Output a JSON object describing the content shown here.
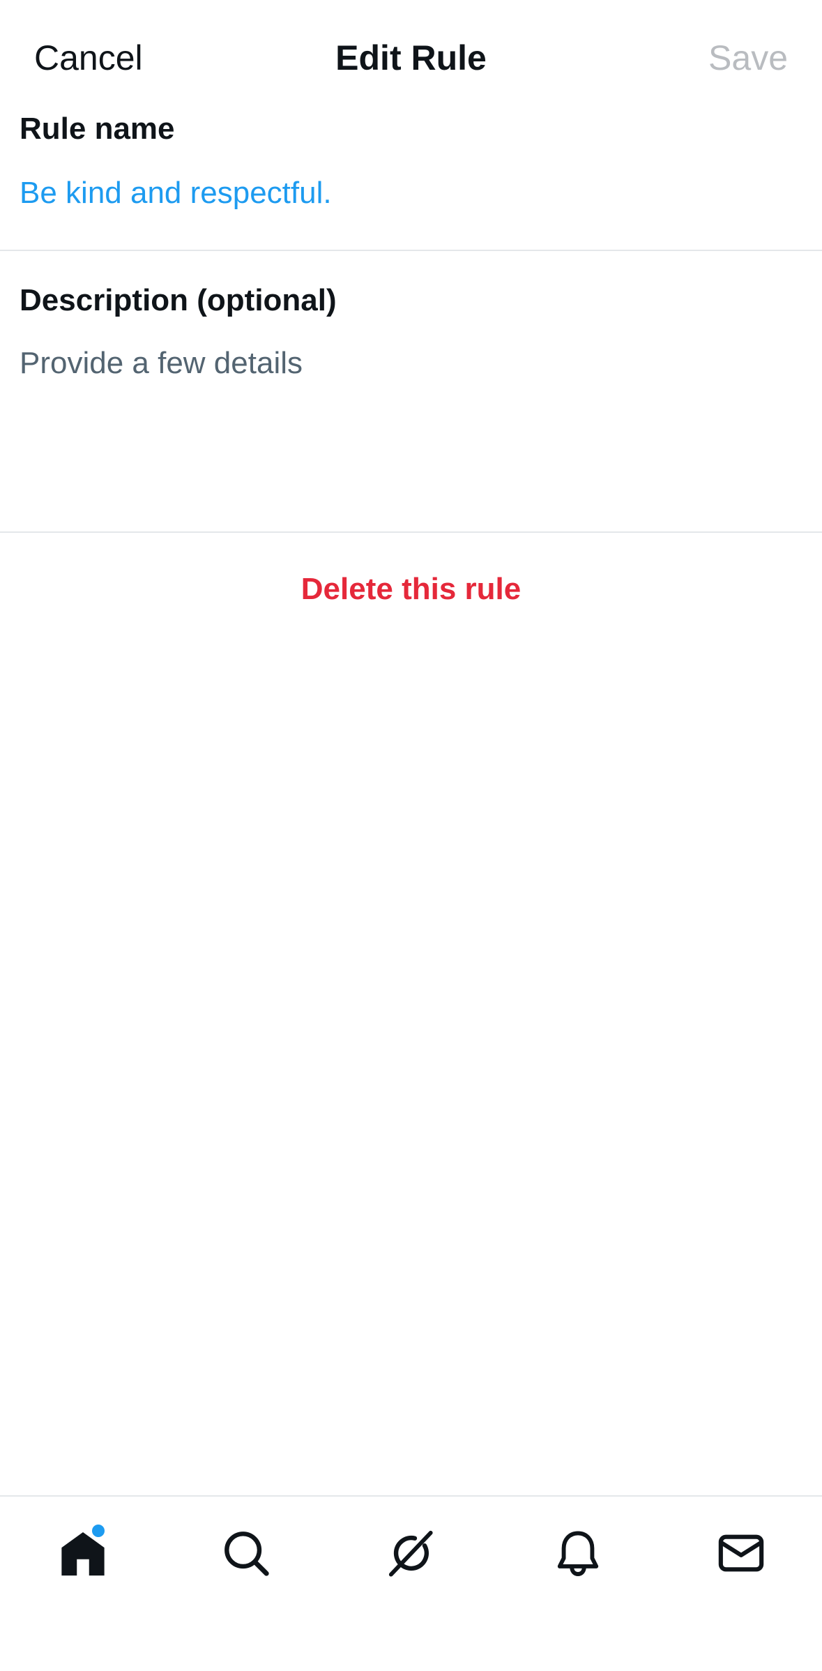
{
  "header": {
    "cancel_label": "Cancel",
    "title": "Edit Rule",
    "save_label": "Save"
  },
  "rule_name": {
    "label": "Rule name",
    "value": "Be kind and respectful."
  },
  "description": {
    "label": "Description (optional)",
    "placeholder": "Provide a few details",
    "value": ""
  },
  "actions": {
    "delete_label": "Delete this rule"
  },
  "tabbar": {
    "items": [
      {
        "icon": "home-icon",
        "active": true,
        "has_notification_dot": true
      },
      {
        "icon": "search-icon",
        "active": false
      },
      {
        "icon": "grok-icon",
        "active": false
      },
      {
        "icon": "bell-icon",
        "active": false
      },
      {
        "icon": "mail-icon",
        "active": false
      }
    ]
  },
  "colors": {
    "accent": "#1d9bf0",
    "destructive": "#e5283a",
    "text_primary": "#0f1419",
    "text_secondary": "#536471",
    "disabled": "#b9bcc0",
    "divider": "#e4e7ea"
  }
}
